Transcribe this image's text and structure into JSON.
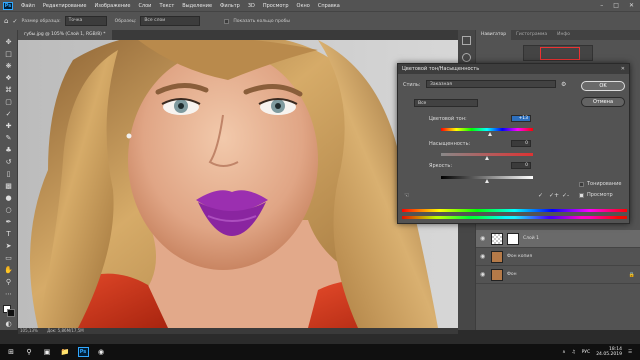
{
  "menu": {
    "items": [
      "Файл",
      "Редактирование",
      "Изображение",
      "Слои",
      "Текст",
      "Выделение",
      "Фильтр",
      "3D",
      "Просмотр",
      "Окно",
      "Справка"
    ],
    "ps_logo": "Ps"
  },
  "options": {
    "sample_size_label": "Размер образца:",
    "sample_size_value": "Точка",
    "sample_label": "Образец:",
    "sample_value": "Все слои",
    "show_ring_label": "Показать кольцо пробы"
  },
  "document": {
    "tab_title": "губы.jpg @ 105% (Слой 1, RGB/8) *",
    "status": "105,13%",
    "doc_size": "Док: 5,86М/17,5М"
  },
  "panels": {
    "tabs": [
      "Навигатор",
      "Гистограмма",
      "Инфо"
    ],
    "active_tab": "Навигатор",
    "layers": [
      {
        "name": "Слой 1",
        "type": "adjustment"
      },
      {
        "name": "Фон копия",
        "type": "image"
      },
      {
        "name": "Фон",
        "type": "image",
        "locked": true
      }
    ]
  },
  "dialog": {
    "title": "Цветовой тон/Насыщенность",
    "close": "✕",
    "preset_label": "Стиль:",
    "preset_value": "Заказная",
    "channel_value": "Все",
    "hue_label": "Цветовой тон:",
    "hue_value": "+13",
    "saturation_label": "Насыщенность:",
    "saturation_value": "0",
    "lightness_label": "Яркость:",
    "lightness_value": "0",
    "ok_label": "OK",
    "cancel_label": "Отмена",
    "colorize_label": "Тонирование",
    "preview_label": "Просмотр",
    "hue_fraction": 0.54,
    "saturation_fraction": 0.5,
    "lightness_fraction": 0.5
  },
  "taskbar": {
    "lang": "РУС",
    "time": "18:14",
    "date": "24.05.2019",
    "ps_label": "Ps"
  },
  "colors": {
    "ui_gray": "#535353",
    "lips": "#9b2fb0",
    "dress": "#d23a1e",
    "hair": "#c89a56",
    "accent_blue": "#2d6fbd"
  }
}
